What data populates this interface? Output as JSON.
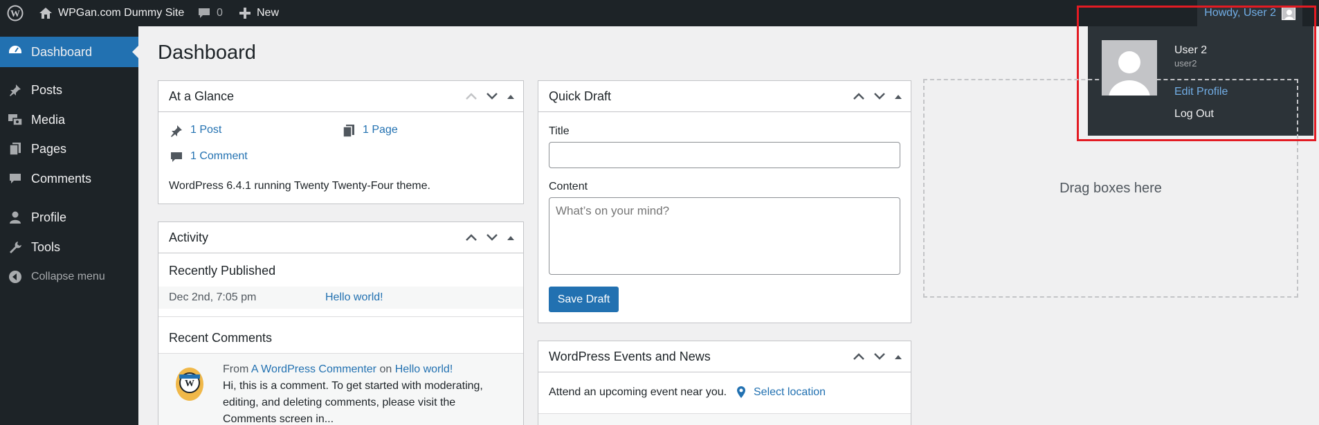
{
  "admin_bar": {
    "logo_icon": "wordpress-logo-icon",
    "site_icon": "home-icon",
    "site_name": "WPGan.com Dummy Site",
    "comments_icon": "comment-bubble-icon",
    "comments_count": "0",
    "new_icon": "plus-icon",
    "new_label": "New",
    "howdy": "Howdy, User 2"
  },
  "user_dropdown": {
    "display_name": "User 2",
    "username": "user2",
    "edit_profile": "Edit Profile",
    "log_out": "Log Out"
  },
  "sidebar": {
    "items": [
      {
        "label": "Dashboard",
        "icon": "dashboard-icon"
      },
      {
        "label": "Posts",
        "icon": "pushpin-icon"
      },
      {
        "label": "Media",
        "icon": "media-icon"
      },
      {
        "label": "Pages",
        "icon": "pages-icon"
      },
      {
        "label": "Comments",
        "icon": "comment-icon"
      },
      {
        "label": "Profile",
        "icon": "user-icon"
      },
      {
        "label": "Tools",
        "icon": "wrench-icon"
      },
      {
        "label": "Collapse menu",
        "icon": "collapse-icon"
      }
    ]
  },
  "page": {
    "title": "Dashboard"
  },
  "at_a_glance": {
    "title": "At a Glance",
    "posts": "1 Post",
    "pages": "1 Page",
    "comments": "1 Comment",
    "version_text": "WordPress 6.4.1 running Twenty Twenty-Four theme."
  },
  "activity": {
    "title": "Activity",
    "recently_published": "Recently Published",
    "pub_date": "Dec 2nd, 7:05 pm",
    "pub_title": "Hello world!",
    "recent_comments": "Recent Comments",
    "comment_from": "From",
    "comment_author": "A WordPress Commenter",
    "comment_on": "on",
    "comment_post": "Hello world!",
    "comment_line1": "Hi, this is a comment. To get started with moderating,",
    "comment_line2": "editing, and deleting comments, please visit the",
    "comment_line3": "Comments screen in..."
  },
  "quick_draft": {
    "title": "Quick Draft",
    "title_label": "Title",
    "title_value": "",
    "content_label": "Content",
    "content_placeholder": "What’s on your mind?",
    "save_button": "Save Draft"
  },
  "events": {
    "title": "WordPress Events and News",
    "attend_text": "Attend an upcoming event near you.",
    "select_location": "Select location"
  },
  "drop_zone": {
    "text": "Drag boxes here"
  },
  "colors": {
    "admin_bar_bg": "#1d2327",
    "sidebar_bg": "#1d2327",
    "accent": "#2271b1",
    "link": "#2271b1",
    "highlight_border": "#e31b23"
  }
}
